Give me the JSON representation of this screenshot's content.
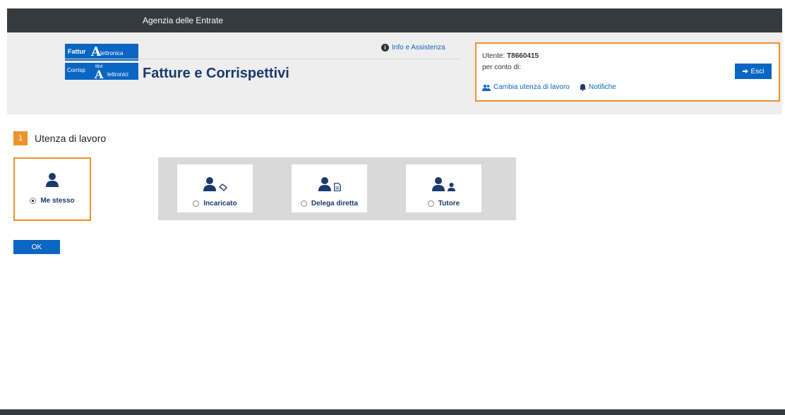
{
  "topbar": {
    "brand": "Agenzia delle Entrate"
  },
  "header": {
    "logo": {
      "line1a": "Fattur",
      "line1b": "lettronica",
      "line2a": "Corrisp",
      "line2b": "ttivi",
      "line2c": "lettronici"
    },
    "title": "Fatture e Corrispettivi",
    "info_link": "Info e Assistenza"
  },
  "user": {
    "label": "Utente:",
    "code": "T8660415",
    "per_conto": "per conto di:",
    "change_link": "Cambia utenza di lavoro",
    "notify_link": "Notifiche",
    "logout": "Esci"
  },
  "step": {
    "number": "1",
    "label": "Utenza di lavoro"
  },
  "options": [
    {
      "label": "Me stesso",
      "selected": true
    },
    {
      "label": "Incaricato",
      "selected": false
    },
    {
      "label": "Delega diretta",
      "selected": false
    },
    {
      "label": "Tutore",
      "selected": false
    }
  ],
  "ok_label": "OK",
  "colors": {
    "primary": "#0a66c2",
    "accent": "#f0922b",
    "dark": "#343a40",
    "title": "#1a3a6b"
  }
}
